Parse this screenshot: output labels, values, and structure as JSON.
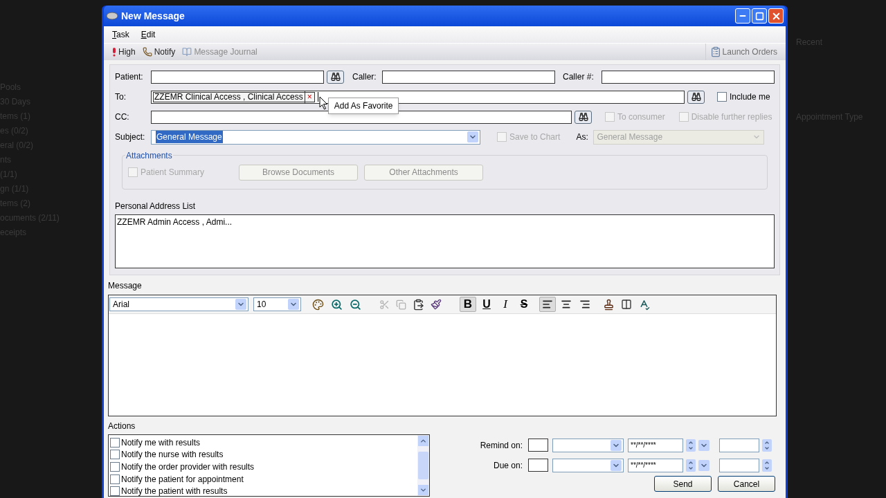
{
  "background": {
    "left_items": [
      "Pools",
      "30 Days",
      "tems (1)",
      "es (0/2)",
      "eral (0/2)",
      "nts",
      "(1/1)",
      "gn (1/1)",
      "tems (2)",
      "ocuments (2/11)",
      "eceipts"
    ],
    "right_items": [
      "Recent",
      "Appointment Type"
    ]
  },
  "window": {
    "title": "New Message"
  },
  "menu": [
    {
      "label": "Task"
    },
    {
      "label": "Edit"
    }
  ],
  "toolbar": [
    {
      "kind": "priority",
      "label": "High",
      "disabled": false
    },
    {
      "kind": "phone",
      "label": "Notify",
      "disabled": false
    },
    {
      "kind": "journal",
      "label": "Message Journal",
      "disabled": true
    }
  ],
  "launch_orders": {
    "label": "Launch Orders",
    "disabled": true
  },
  "form": {
    "patient_label": "Patient:",
    "caller_label": "Caller:",
    "caller_number_label": "Caller #:",
    "to_label": "To:",
    "to_recipient": "ZZEMR Clinical Access , Clinical Access",
    "remove_mark": "×",
    "include_me": {
      "label": "Include me",
      "checked": false,
      "disabled": false
    },
    "cc_label": "CC:",
    "to_consumer": {
      "label": "To consumer",
      "checked": false,
      "disabled": true
    },
    "disable_replies": {
      "label": "Disable further replies",
      "checked": false,
      "disabled": true
    },
    "subject_label": "Subject:",
    "subject_value": "General Message",
    "save_to_chart": {
      "label": "Save to Chart",
      "checked": false,
      "disabled": true
    },
    "as_label": "As:",
    "as_value": "General Message"
  },
  "context_menu": {
    "item": "Add As Favorite"
  },
  "attachments": {
    "title": "Attachments",
    "patient_summary": {
      "label": "Patient Summary",
      "checked": false,
      "disabled": true
    },
    "buttons": [
      "Browse Documents",
      "Other Attachments"
    ]
  },
  "address_list": {
    "title": "Personal Address List",
    "entries": [
      "ZZEMR Admin Access , Admi..."
    ]
  },
  "message": {
    "title": "Message",
    "font": "Arial",
    "size": "10",
    "format_buttons": [
      {
        "label": "B",
        "kind": "bold",
        "pressed": true
      },
      {
        "label": "U",
        "kind": "underline",
        "pressed": false
      },
      {
        "label": "I",
        "kind": "italic",
        "pressed": false
      },
      {
        "label": "S",
        "kind": "strike",
        "pressed": false
      }
    ],
    "align": [
      {
        "kind": "left",
        "selected": true
      },
      {
        "kind": "center",
        "selected": false
      },
      {
        "kind": "right",
        "selected": false
      }
    ]
  },
  "actions": {
    "title": "Actions",
    "items": [
      {
        "label": "Notify me with results",
        "checked": false
      },
      {
        "label": "Notify the nurse with results",
        "checked": false
      },
      {
        "label": "Notify the order provider with results",
        "checked": false
      },
      {
        "label": "Notify the patient for appointment",
        "checked": false
      },
      {
        "label": "Notify the patient with results",
        "checked": false
      }
    ]
  },
  "schedule": [
    {
      "label": "Remind on:",
      "date": "**/**/****"
    },
    {
      "label": "Due on:",
      "date": "**/**/****"
    }
  ],
  "buttons": [
    "Send",
    "Cancel"
  ]
}
